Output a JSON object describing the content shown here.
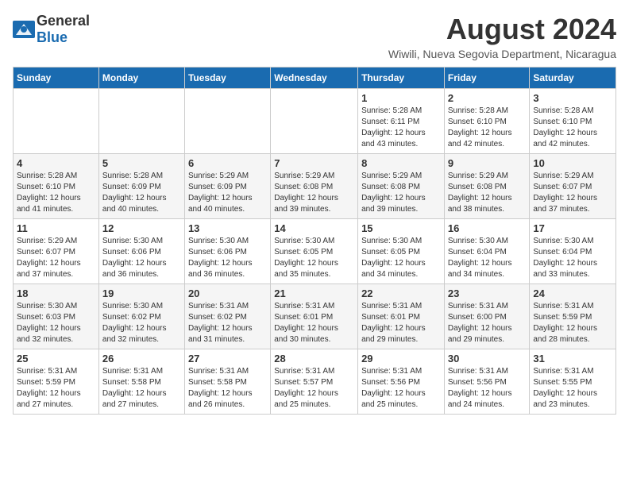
{
  "header": {
    "logo_general": "General",
    "logo_blue": "Blue",
    "title": "August 2024",
    "location": "Wiwili, Nueva Segovia Department, Nicaragua"
  },
  "calendar": {
    "headers": [
      "Sunday",
      "Monday",
      "Tuesday",
      "Wednesday",
      "Thursday",
      "Friday",
      "Saturday"
    ],
    "weeks": [
      [
        {
          "day": "",
          "detail": ""
        },
        {
          "day": "",
          "detail": ""
        },
        {
          "day": "",
          "detail": ""
        },
        {
          "day": "",
          "detail": ""
        },
        {
          "day": "1",
          "detail": "Sunrise: 5:28 AM\nSunset: 6:11 PM\nDaylight: 12 hours\nand 43 minutes."
        },
        {
          "day": "2",
          "detail": "Sunrise: 5:28 AM\nSunset: 6:10 PM\nDaylight: 12 hours\nand 42 minutes."
        },
        {
          "day": "3",
          "detail": "Sunrise: 5:28 AM\nSunset: 6:10 PM\nDaylight: 12 hours\nand 42 minutes."
        }
      ],
      [
        {
          "day": "4",
          "detail": "Sunrise: 5:28 AM\nSunset: 6:10 PM\nDaylight: 12 hours\nand 41 minutes."
        },
        {
          "day": "5",
          "detail": "Sunrise: 5:28 AM\nSunset: 6:09 PM\nDaylight: 12 hours\nand 40 minutes."
        },
        {
          "day": "6",
          "detail": "Sunrise: 5:29 AM\nSunset: 6:09 PM\nDaylight: 12 hours\nand 40 minutes."
        },
        {
          "day": "7",
          "detail": "Sunrise: 5:29 AM\nSunset: 6:08 PM\nDaylight: 12 hours\nand 39 minutes."
        },
        {
          "day": "8",
          "detail": "Sunrise: 5:29 AM\nSunset: 6:08 PM\nDaylight: 12 hours\nand 39 minutes."
        },
        {
          "day": "9",
          "detail": "Sunrise: 5:29 AM\nSunset: 6:08 PM\nDaylight: 12 hours\nand 38 minutes."
        },
        {
          "day": "10",
          "detail": "Sunrise: 5:29 AM\nSunset: 6:07 PM\nDaylight: 12 hours\nand 37 minutes."
        }
      ],
      [
        {
          "day": "11",
          "detail": "Sunrise: 5:29 AM\nSunset: 6:07 PM\nDaylight: 12 hours\nand 37 minutes."
        },
        {
          "day": "12",
          "detail": "Sunrise: 5:30 AM\nSunset: 6:06 PM\nDaylight: 12 hours\nand 36 minutes."
        },
        {
          "day": "13",
          "detail": "Sunrise: 5:30 AM\nSunset: 6:06 PM\nDaylight: 12 hours\nand 36 minutes."
        },
        {
          "day": "14",
          "detail": "Sunrise: 5:30 AM\nSunset: 6:05 PM\nDaylight: 12 hours\nand 35 minutes."
        },
        {
          "day": "15",
          "detail": "Sunrise: 5:30 AM\nSunset: 6:05 PM\nDaylight: 12 hours\nand 34 minutes."
        },
        {
          "day": "16",
          "detail": "Sunrise: 5:30 AM\nSunset: 6:04 PM\nDaylight: 12 hours\nand 34 minutes."
        },
        {
          "day": "17",
          "detail": "Sunrise: 5:30 AM\nSunset: 6:04 PM\nDaylight: 12 hours\nand 33 minutes."
        }
      ],
      [
        {
          "day": "18",
          "detail": "Sunrise: 5:30 AM\nSunset: 6:03 PM\nDaylight: 12 hours\nand 32 minutes."
        },
        {
          "day": "19",
          "detail": "Sunrise: 5:30 AM\nSunset: 6:02 PM\nDaylight: 12 hours\nand 32 minutes."
        },
        {
          "day": "20",
          "detail": "Sunrise: 5:31 AM\nSunset: 6:02 PM\nDaylight: 12 hours\nand 31 minutes."
        },
        {
          "day": "21",
          "detail": "Sunrise: 5:31 AM\nSunset: 6:01 PM\nDaylight: 12 hours\nand 30 minutes."
        },
        {
          "day": "22",
          "detail": "Sunrise: 5:31 AM\nSunset: 6:01 PM\nDaylight: 12 hours\nand 29 minutes."
        },
        {
          "day": "23",
          "detail": "Sunrise: 5:31 AM\nSunset: 6:00 PM\nDaylight: 12 hours\nand 29 minutes."
        },
        {
          "day": "24",
          "detail": "Sunrise: 5:31 AM\nSunset: 5:59 PM\nDaylight: 12 hours\nand 28 minutes."
        }
      ],
      [
        {
          "day": "25",
          "detail": "Sunrise: 5:31 AM\nSunset: 5:59 PM\nDaylight: 12 hours\nand 27 minutes."
        },
        {
          "day": "26",
          "detail": "Sunrise: 5:31 AM\nSunset: 5:58 PM\nDaylight: 12 hours\nand 27 minutes."
        },
        {
          "day": "27",
          "detail": "Sunrise: 5:31 AM\nSunset: 5:58 PM\nDaylight: 12 hours\nand 26 minutes."
        },
        {
          "day": "28",
          "detail": "Sunrise: 5:31 AM\nSunset: 5:57 PM\nDaylight: 12 hours\nand 25 minutes."
        },
        {
          "day": "29",
          "detail": "Sunrise: 5:31 AM\nSunset: 5:56 PM\nDaylight: 12 hours\nand 25 minutes."
        },
        {
          "day": "30",
          "detail": "Sunrise: 5:31 AM\nSunset: 5:56 PM\nDaylight: 12 hours\nand 24 minutes."
        },
        {
          "day": "31",
          "detail": "Sunrise: 5:31 AM\nSunset: 5:55 PM\nDaylight: 12 hours\nand 23 minutes."
        }
      ]
    ]
  }
}
